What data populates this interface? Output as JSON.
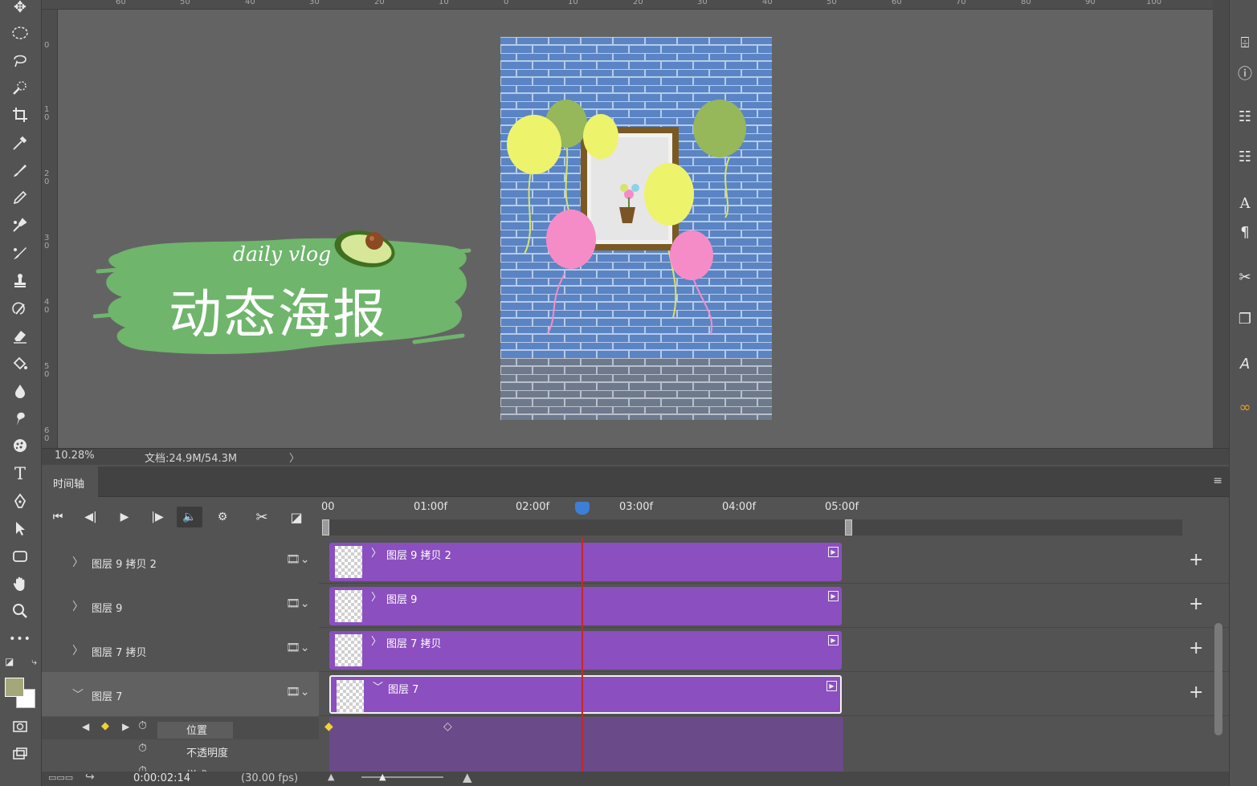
{
  "toolbar": {
    "tools": [
      "move-tool-icon",
      "marquee-tool-icon",
      "lasso-tool-icon",
      "quick-select-tool-icon",
      "crop-tool-icon",
      "eyedropper-tool-icon",
      "brush-tool-icon",
      "pencil-tool-icon",
      "clone-stamp-tool-icon",
      "healing-brush-tool-icon",
      "stamp-tool-icon",
      "history-brush-tool-icon",
      "eraser-tool-icon",
      "paint-bucket-tool-icon",
      "blur-tool-icon",
      "smudge-tool-icon",
      "sponge-tool-icon",
      "type-tool-icon",
      "pen-tool-icon",
      "path-select-tool-icon",
      "rectangle-tool-icon",
      "hand-tool-icon",
      "zoom-tool-icon",
      "more-tools-icon"
    ],
    "type_tool_glyph": "T",
    "more_glyph": "•••",
    "foreground_color": "#a4a77a",
    "background_color": "#ffffff"
  },
  "rulers": {
    "top_labels": [
      "60",
      "50",
      "40",
      "30",
      "20",
      "10",
      "0",
      "10",
      "20",
      "30",
      "40",
      "50",
      "60",
      "70",
      "80",
      "90",
      "100"
    ],
    "left_labels": [
      "0",
      "10",
      "20",
      "30",
      "40",
      "50",
      "60"
    ]
  },
  "poster": {
    "title_small": "daily vlog",
    "title_main": "动态海报",
    "brush_color": "#6fb56c",
    "wall_color": "#5a84c4"
  },
  "status": {
    "zoom": "10.28%",
    "doc": "文档:24.9M/54.3M",
    "arrow": "〉"
  },
  "timeline": {
    "tab": "时间轴",
    "menu_icon": "≡",
    "time_labels": [
      "00",
      "01:00f",
      "02:00f",
      "03:00f",
      "04:00f",
      "05:00f"
    ],
    "layers": [
      {
        "name": "图层 9 拷贝 2",
        "toggle": "〉"
      },
      {
        "name": "图层 9",
        "toggle": "〉"
      },
      {
        "name": "图层 7 拷贝",
        "toggle": "〉"
      },
      {
        "name": "图层 7",
        "toggle": "﹀"
      }
    ],
    "properties": [
      "位置",
      "不透明度",
      "样式"
    ],
    "add_label": "+",
    "current_time": "0:00:02:14",
    "fps": "(30.00 fps)"
  }
}
